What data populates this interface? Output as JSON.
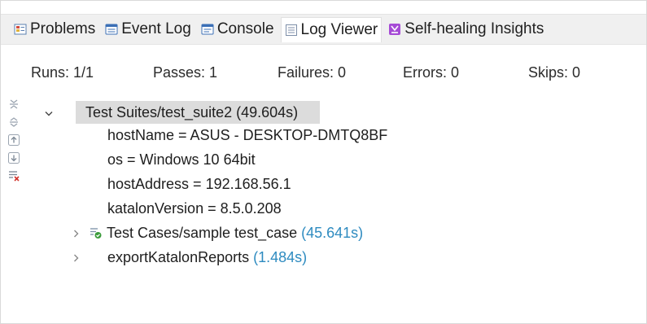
{
  "tabs": [
    {
      "label": "Problems",
      "icon": "problems-icon"
    },
    {
      "label": "Event Log",
      "icon": "event-log-icon"
    },
    {
      "label": "Console",
      "icon": "console-icon"
    },
    {
      "label": "Log Viewer",
      "icon": "log-viewer-icon",
      "active": true
    },
    {
      "label": "Self-healing Insights",
      "icon": "self-healing-icon"
    }
  ],
  "stats": {
    "runs": "Runs: 1/1",
    "passes": "Passes: 1",
    "failures": "Failures: 0",
    "errors": "Errors: 0",
    "skips": "Skips: 0"
  },
  "sidebar": [
    "collapse-all-icon",
    "expand-all-icon",
    "previous-icon",
    "next-icon",
    "clear-icon"
  ],
  "tree": {
    "suite_label": "Test Suites/test_suite2",
    "suite_duration": "(49.604s)",
    "properties": [
      "hostName = ASUS - DESKTOP-DMTQ8BF",
      "os = Windows 10 64bit",
      "hostAddress = 192.168.56.1",
      "katalonVersion = 8.5.0.208"
    ],
    "test_case_label": "Test Cases/sample test_case",
    "test_case_duration": "(45.641s)",
    "export_label": "exportKatalonReports",
    "export_duration": "(1.484s)"
  },
  "colors": {
    "accent": "#2e8bc0",
    "selection": "#dcdcdc",
    "pass": "#3a9b3a"
  }
}
